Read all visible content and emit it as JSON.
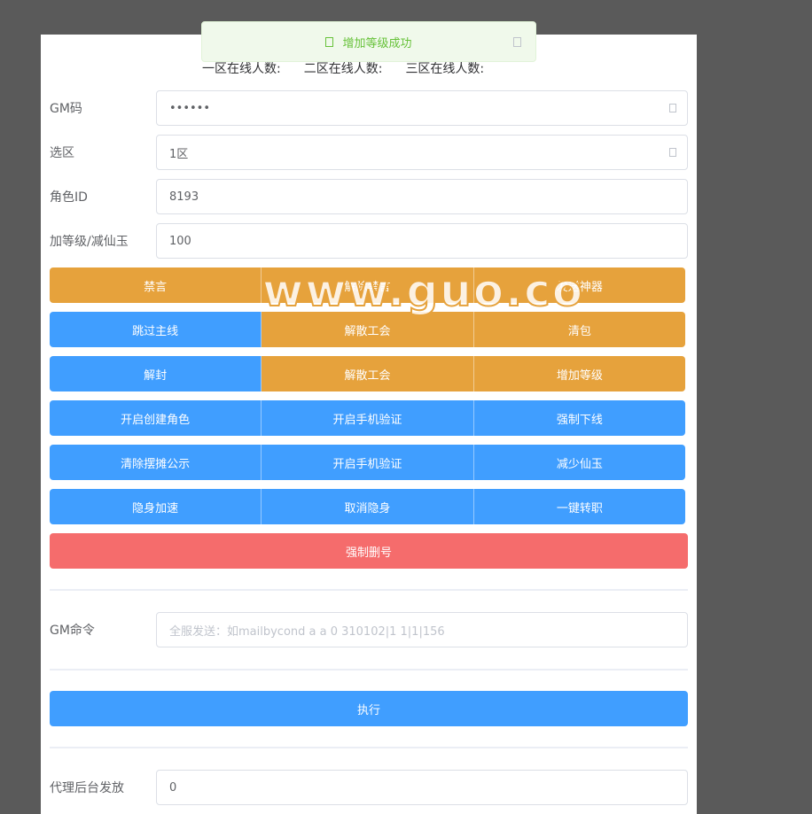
{
  "toast": {
    "message": "增加等级成功"
  },
  "online": [
    "一区在线人数:",
    "二区在线人数:",
    "三区在线人数:"
  ],
  "fields": {
    "gm_code": {
      "label": "GM码",
      "value": "••••••"
    },
    "zone": {
      "label": "选区",
      "value": "1区"
    },
    "role_id": {
      "label": "角色ID",
      "value": "8193"
    },
    "amount": {
      "label": "加等级/减仙玉",
      "value": "100"
    }
  },
  "buttons": [
    [
      "禁言",
      "解除禁言",
      "发送神器"
    ],
    [
      "跳过主线",
      "解散工会",
      "清包"
    ],
    [
      "解封",
      "解散工会",
      "增加等级"
    ],
    [
      "开启创建角色",
      "开启手机验证",
      "强制下线"
    ],
    [
      "清除摆摊公示",
      "开启手机验证",
      "减少仙玉"
    ],
    [
      "隐身加速",
      "取消隐身",
      "一键转职"
    ]
  ],
  "delete_button": "强制删号",
  "gm_command": {
    "label": "GM命令",
    "placeholder": "全服发送：如mailbycond a a 0 310102|1 1|1|156"
  },
  "execute_button": "执行",
  "agent": {
    "label": "代理后台发放",
    "value": "0"
  },
  "watermark": "www.guo.co",
  "colors": {
    "primary": "#409eff",
    "warning": "#e6a23c",
    "danger": "#f56c6c",
    "success": "#67c23a"
  }
}
